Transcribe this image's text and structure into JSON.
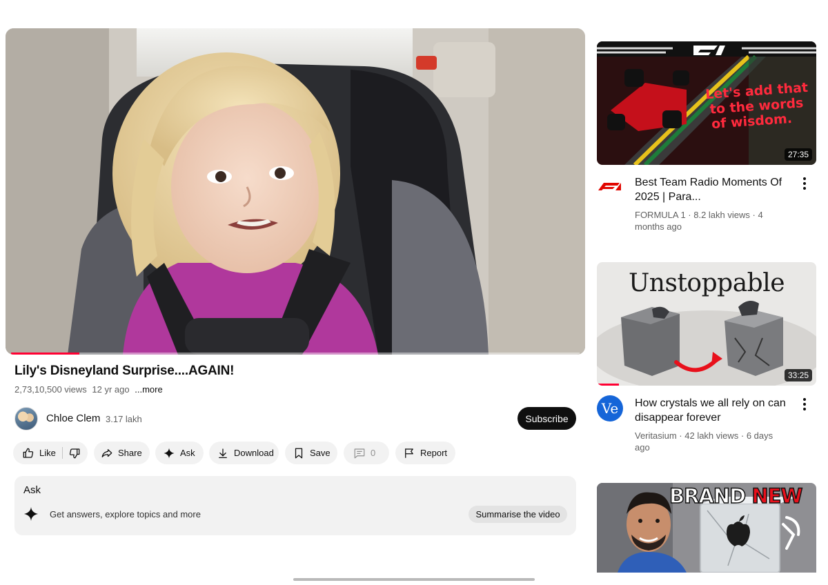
{
  "player": {
    "progress_fraction": 0.12
  },
  "video": {
    "title": "Lily's Disneyland Surprise....AGAIN!",
    "views": "2,73,10,500 views",
    "age": "12 yr ago",
    "more": "...more"
  },
  "channel": {
    "name": "Chloe Clem",
    "subscribers": "3.17 lakh",
    "subscribe_label": "Subscribe"
  },
  "actions": {
    "like": "Like",
    "share": "Share",
    "ask": "Ask",
    "download": "Download",
    "save": "Save",
    "comments": "0",
    "report": "Report"
  },
  "ask_panel": {
    "title": "Ask",
    "subtitle": "Get answers, explore topics and more",
    "summarise_label": "Summarise the video"
  },
  "recommendations": [
    {
      "thumb_text": "Let's add that to the words of wisdom.",
      "duration": "27:35",
      "title": "Best Team Radio Moments Of 2025 | Para...",
      "channel": "FORMULA 1",
      "meta": "FORMULA 1 · 8.2 lakh views · 4 months ago",
      "avatar_icon": "f1-logo-icon"
    },
    {
      "thumb_text": "Unstoppable",
      "duration": "33:25",
      "progress_fraction": 0.1,
      "title": "How crystals we all rely on can disappear forever",
      "avatar_text": "Ve",
      "meta": "Veritasium · 42 lakh views · 6 days ago"
    },
    {
      "thumb_text_1": "BRAND",
      "thumb_text_2": "NEW"
    }
  ],
  "colors": {
    "accent_red": "#ff0033",
    "chip_bg": "#f2f2f2",
    "subscribe_bg": "#0f0f0f"
  }
}
